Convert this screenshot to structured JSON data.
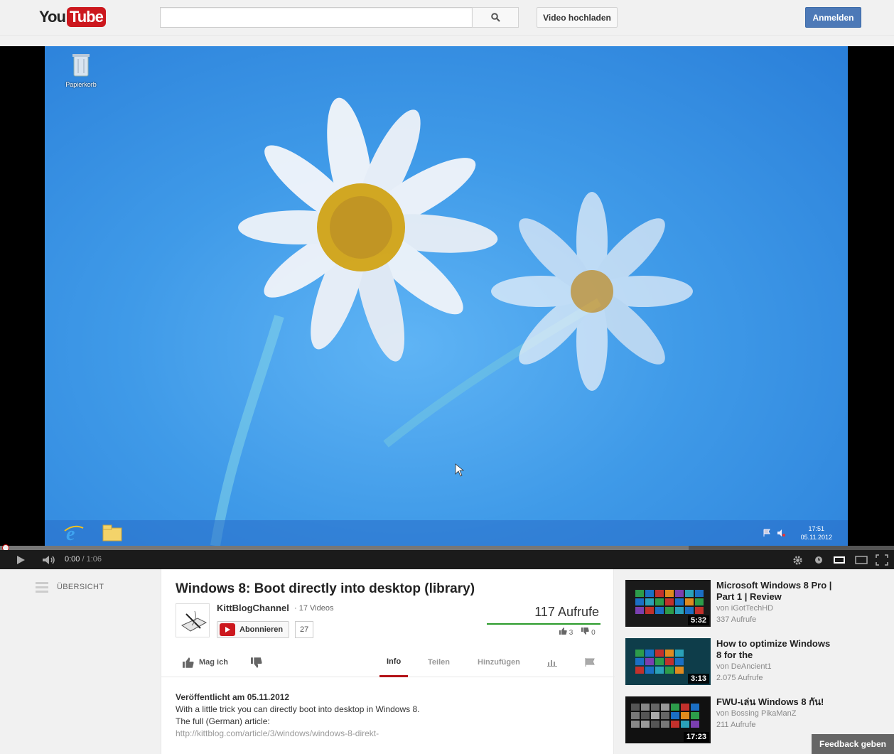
{
  "header": {
    "logo_you": "You",
    "logo_tube": "Tube",
    "search_placeholder": "",
    "search_icon": "search-icon",
    "upload_label": "Video hochladen",
    "login_label": "Anmelden"
  },
  "player": {
    "desktop_icon_label": "Papierkorb",
    "tray_time": "17:51",
    "tray_date": "05.11.2012",
    "current_time": "0:00",
    "duration": "1:06",
    "time_separator": " / ",
    "progress_fraction": 0.0,
    "buffered_fraction": 0.77,
    "icons": [
      "play-icon",
      "volume-icon",
      "settings-icon",
      "watch-later-icon",
      "theater-mode-icon",
      "small-player-icon",
      "fullscreen-icon"
    ]
  },
  "guide": {
    "label": "ÜBERSICHT"
  },
  "video": {
    "title": "Windows 8: Boot directly into desktop (library)",
    "channel": "KittBlogChannel",
    "video_count": "17 Videos",
    "subscribe_label": "Abonnieren",
    "subscriber_count": "27",
    "views": "117 Aufrufe",
    "likes": "3",
    "dislikes": "0"
  },
  "actions": {
    "like_label": "Mag ich",
    "tabs": [
      "Info",
      "Teilen",
      "Hinzufügen"
    ],
    "active_tab": "Info"
  },
  "description": {
    "published": "Veröffentlicht am 05.11.2012",
    "line1": "With a little trick you can directly boot into desktop in Windows 8.",
    "line2": "The full (German) article:",
    "link": "http://kittblog.com/article/3/windows/windows-8-direkt-"
  },
  "related": [
    {
      "title": "Microsoft Windows 8 Pro | Part 1 | Review",
      "by": "von iGotTechHD",
      "views": "337 Aufrufe",
      "duration": "5:32"
    },
    {
      "title": "How to optimize Windows 8 for the",
      "by": "von DeAncient1",
      "views": "2.075 Aufrufe",
      "duration": "3:13"
    },
    {
      "title": "FWU-เล่น Windows 8 กัน!",
      "by": "von Bossing PikaManZ",
      "views": "211 Aufrufe",
      "duration": "17:23"
    }
  ],
  "feedback_label": "Feedback geben",
  "colors": {
    "brand_red": "#cc181e",
    "login_blue": "#4d79b7",
    "view_bar_green": "#2b9b2b"
  }
}
